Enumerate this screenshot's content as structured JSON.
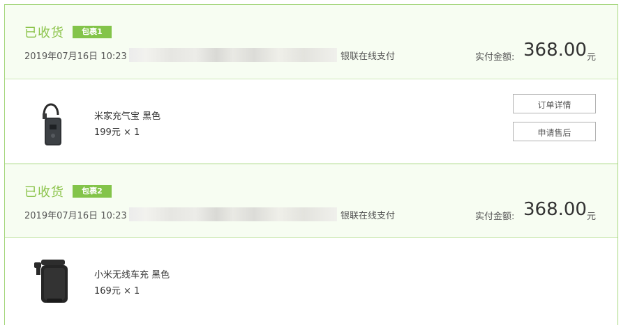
{
  "orders": [
    {
      "status": "已收货",
      "badge": "包裹1",
      "datetime": "2019年07月16日 10:23",
      "payment": "银联在线支付",
      "total_label": "实付金额:",
      "total_value": "368.00",
      "total_unit": "元",
      "item": {
        "name": "米家充气宝 黑色",
        "price": "199元 × 1",
        "icon": "air-pump-product-image"
      },
      "actions": {
        "detail": "订单详情",
        "after_sale": "申请售后"
      }
    },
    {
      "status": "已收货",
      "badge": "包裹2",
      "datetime": "2019年07月16日 10:23",
      "payment": "银联在线支付",
      "total_label": "实付金额:",
      "total_value": "368.00",
      "total_unit": "元",
      "item": {
        "name": "小米无线车充 黑色",
        "price": "169元 × 1",
        "icon": "car-charger-product-image"
      }
    }
  ],
  "colors": {
    "accent_green": "#83c44a",
    "header_bg": "#f7fdf2",
    "border": "#a6d77f"
  }
}
